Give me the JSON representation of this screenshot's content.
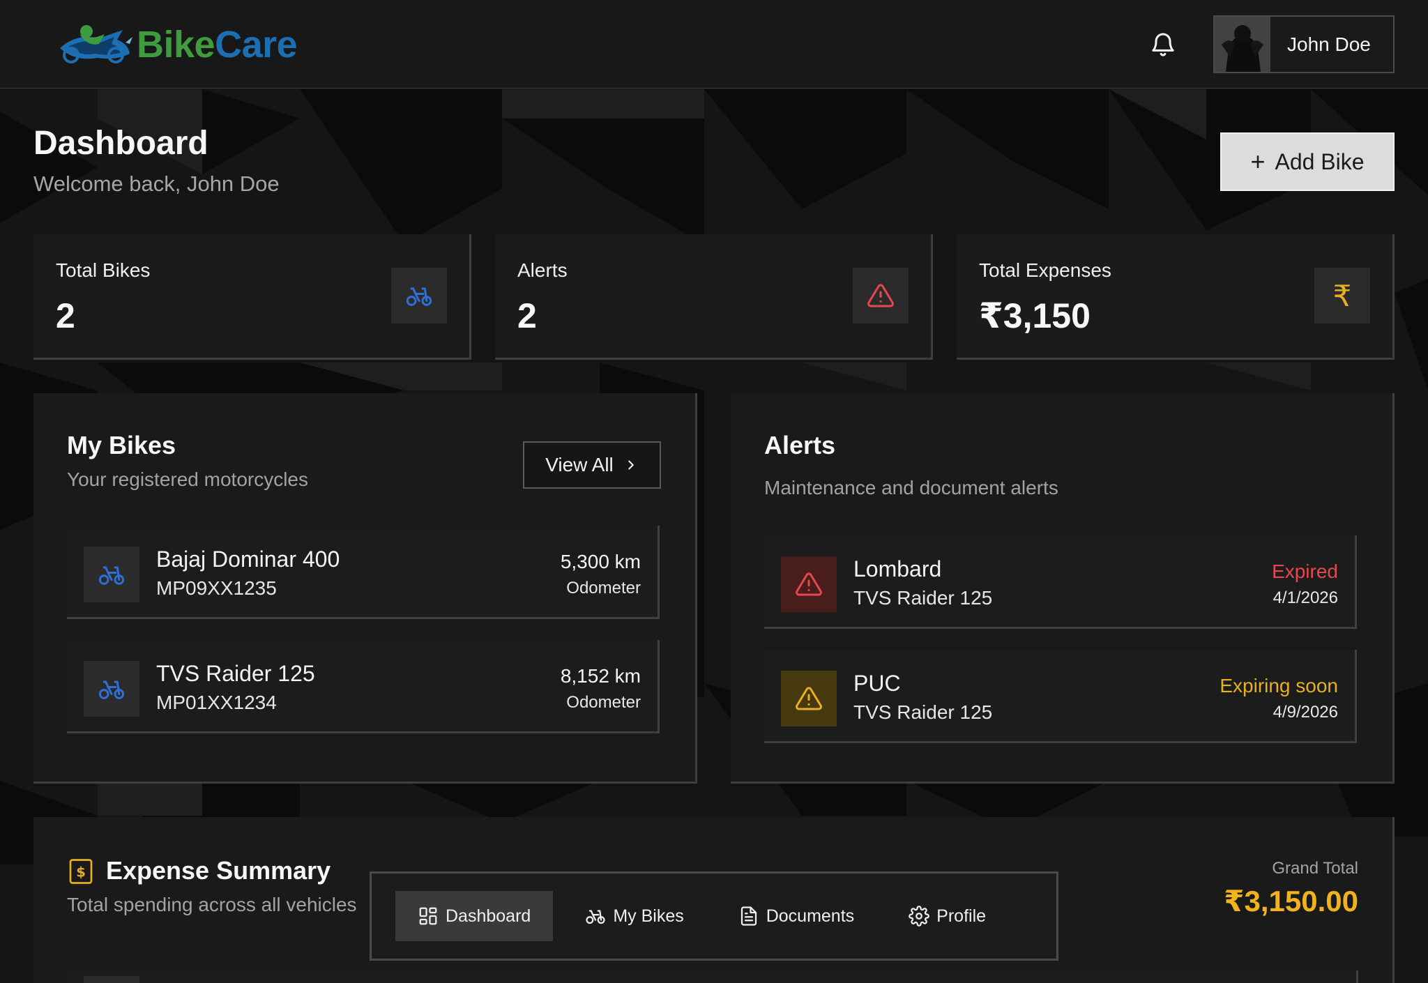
{
  "brand": {
    "name_part1": "Bike",
    "name_part2": "Care",
    "colors": {
      "green": "#3e9b3f",
      "blue": "#1d6fb3"
    }
  },
  "header": {
    "notification_icon": "bell-icon",
    "user_name": "John Doe"
  },
  "page": {
    "title": "Dashboard",
    "subtitle": "Welcome back, John Doe",
    "add_button_label": "Add Bike"
  },
  "stats": [
    {
      "label": "Total Bikes",
      "value": "2",
      "icon": "bike-icon",
      "icon_color": "#2f6fd9"
    },
    {
      "label": "Alerts",
      "value": "2",
      "icon": "warning-triangle-icon",
      "icon_color": "#e5484d"
    },
    {
      "label": "Total Expenses",
      "value": "₹3,150",
      "icon": "rupee-icon",
      "icon_color": "#e6b020"
    }
  ],
  "my_bikes": {
    "title": "My Bikes",
    "subtitle": "Your registered motorcycles",
    "view_all_label": "View All",
    "items": [
      {
        "name": "Bajaj Dominar 400",
        "reg": "MP09XX1235",
        "odometer": "5,300 km",
        "odometer_label": "Odometer"
      },
      {
        "name": "TVS Raider 125",
        "reg": "MP01XX1234",
        "odometer": "8,152 km",
        "odometer_label": "Odometer"
      }
    ]
  },
  "alerts": {
    "title": "Alerts",
    "subtitle": "Maintenance and document alerts",
    "items": [
      {
        "type": "Lombard",
        "bike": "TVS Raider 125",
        "status": "Expired",
        "date": "4/1/2026",
        "status_color": "#e5484d"
      },
      {
        "type": "PUC",
        "bike": "TVS Raider 125",
        "status": "Expiring soon",
        "date": "4/9/2026",
        "status_color": "#e6b020"
      }
    ]
  },
  "expense_summary": {
    "title": "Expense Summary",
    "subtitle": "Total spending across all vehicles",
    "grand_total_label": "Grand Total",
    "grand_total_value": "₹3,150.00"
  },
  "bottom_nav": {
    "items": [
      {
        "label": "Dashboard",
        "icon": "dashboard-grid-icon",
        "active": true
      },
      {
        "label": "My Bikes",
        "icon": "bike-icon",
        "active": false
      },
      {
        "label": "Documents",
        "icon": "document-icon",
        "active": false
      },
      {
        "label": "Profile",
        "icon": "gear-icon",
        "active": false
      }
    ]
  }
}
